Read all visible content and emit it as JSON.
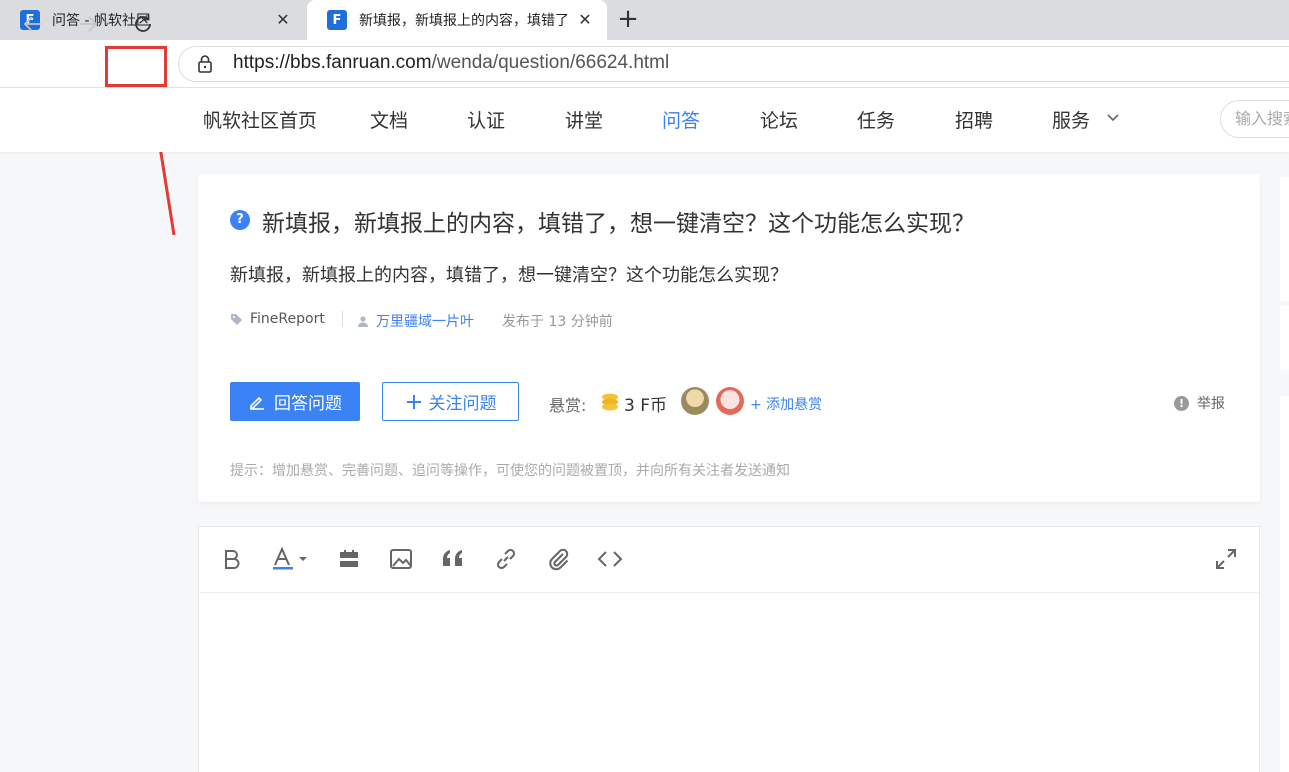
{
  "browser": {
    "tabs": [
      {
        "title": "问答 - 帆软社区",
        "active": false
      },
      {
        "title": "新填报，新填报上的内容，填错了",
        "active": true
      }
    ],
    "address": {
      "scheme": "https://",
      "host": "bbs.fanruan.com",
      "path": "/wenda/question/66624.html"
    }
  },
  "site_nav": {
    "items": [
      "帆软社区首页",
      "文档",
      "认证",
      "讲堂",
      "问答",
      "论坛",
      "任务",
      "招聘",
      "服务"
    ],
    "active": "问答",
    "search_placeholder": "输入搜索"
  },
  "question": {
    "title": "新填报，新填报上的内容，填错了，想一键清空？这个功能怎么实现？",
    "body": "新填报，新填报上的内容，填错了，想一键清空？这个功能怎么实现？",
    "tag": "FineReport",
    "author": "万里疆域一片叶",
    "posted": "发布于 13 分钟前",
    "answer_button": "回答问题",
    "follow_button": "关注问题",
    "bounty_label": "悬赏:",
    "bounty_amount": "3 F币",
    "add_bounty": "+ 添加悬赏",
    "report": "举报",
    "tip": "提示：增加悬赏、完善问题、追问等操作，可使您的问题被置顶，并向所有关注者发送通知"
  },
  "editor": {
    "tools": [
      "bold-icon",
      "text-color-icon",
      "divider-icon",
      "image-icon",
      "quote-icon",
      "link-icon",
      "attachment-icon",
      "code-icon",
      "fullscreen-icon"
    ]
  },
  "colors": {
    "accent": "#3b82f6",
    "highlight": "#e53935"
  }
}
